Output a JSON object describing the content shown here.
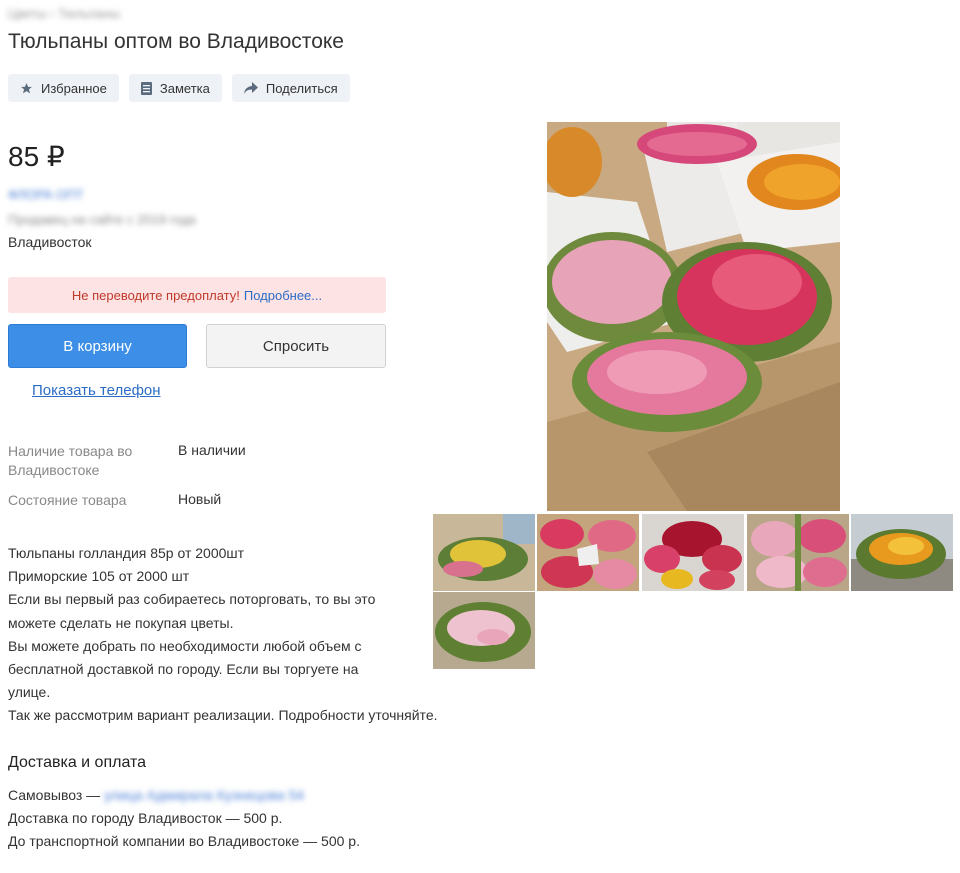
{
  "breadcrumb": "Цветы › Тюльпаны",
  "title": "Тюльпаны оптом во Владивостоке",
  "actions": {
    "favorite": "Избранное",
    "note": "Заметка",
    "share": "Поделиться"
  },
  "price": "85 ₽",
  "seller": {
    "name": "ФЛОРА ОПТ",
    "meta": "Продавец на сайте с 2019 года"
  },
  "city": "Владивосток",
  "warning": {
    "text": "Не переводите предоплату!",
    "link": "Подробнее..."
  },
  "buttons": {
    "cart": "В корзину",
    "ask": "Спросить",
    "phone": "Показать телефон"
  },
  "specs": [
    {
      "label": "Наличие товара во Владивостоке",
      "value": "В наличии"
    },
    {
      "label": "Состояние товара",
      "value": "Новый"
    }
  ],
  "description": [
    "Тюльпаны голландия 85р от 2000шт",
    "Приморские 105 от 2000 шт",
    "Если вы первый раз собираетесь поторговать, то вы это",
    "можете сделать не покупая цветы.",
    "Вы можете добрать по необходимости любой объем с",
    "бесплатной доставкой по городу. Если вы торгуете на",
    "улице.",
    "Так же рассмотрим вариант реализации. Подробности уточняйте."
  ],
  "delivery": {
    "heading": "Доставка и оплата",
    "pickup_label": "Самовывоз —",
    "pickup_address": "улица Адмирала Кузнецова 54",
    "city_delivery": "Доставка по городу Владивосток — 500 р.",
    "transport": "До транспортной компании во Владивостоке — 500 р."
  },
  "icons": {
    "favorite": "star-icon",
    "note": "note-icon",
    "share": "share-arrow-icon"
  },
  "colors": {
    "accent": "#3c8ee6",
    "warning_bg": "#fde3e3",
    "link": "#2b6cc4"
  }
}
